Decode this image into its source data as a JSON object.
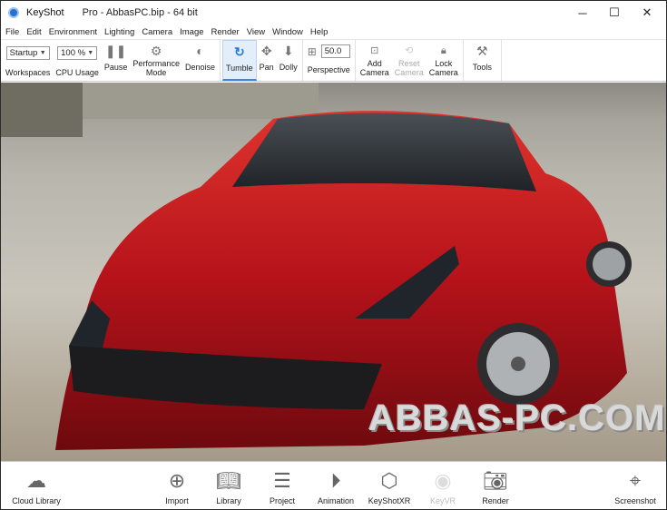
{
  "title": {
    "app": "KeyShot",
    "doc": "Pro  - AbbasPC.bip  - 64 bit",
    "minimize": "─",
    "maximize": "☐",
    "close": "✕"
  },
  "menu": [
    "File",
    "Edit",
    "Environment",
    "Lighting",
    "Camera",
    "Image",
    "Render",
    "View",
    "Window",
    "Help"
  ],
  "toolbar": {
    "workspace_value": "Startup",
    "workspace_label": "Workspaces",
    "cpu_value": "100 %",
    "cpu_label": "CPU Usage",
    "pause": "Pause",
    "performance_mode": [
      "Performance",
      "Mode"
    ],
    "denoise": "Denoise",
    "tumble": "Tumble",
    "pan": "Pan",
    "dolly": "Dolly",
    "fov_value": "50.0",
    "perspective": "Perspective",
    "add_camera": [
      "Add",
      "Camera"
    ],
    "reset_camera": [
      "Reset",
      "Camera"
    ],
    "lock_camera": [
      "Lock",
      "Camera"
    ],
    "tools": "Tools"
  },
  "viewport": {
    "watermark": "ABBAS-PC.COM"
  },
  "bottom": {
    "cloud_library": "Cloud Library",
    "import": "Import",
    "library": "Library",
    "project": "Project",
    "animation": "Animation",
    "keyshotxr": "KeyShotXR",
    "keyvr": "KeyVR",
    "render": "Render",
    "screenshot": "Screenshot"
  },
  "colors": {
    "accent": "#2a7ad6",
    "car": "#c0141a"
  }
}
